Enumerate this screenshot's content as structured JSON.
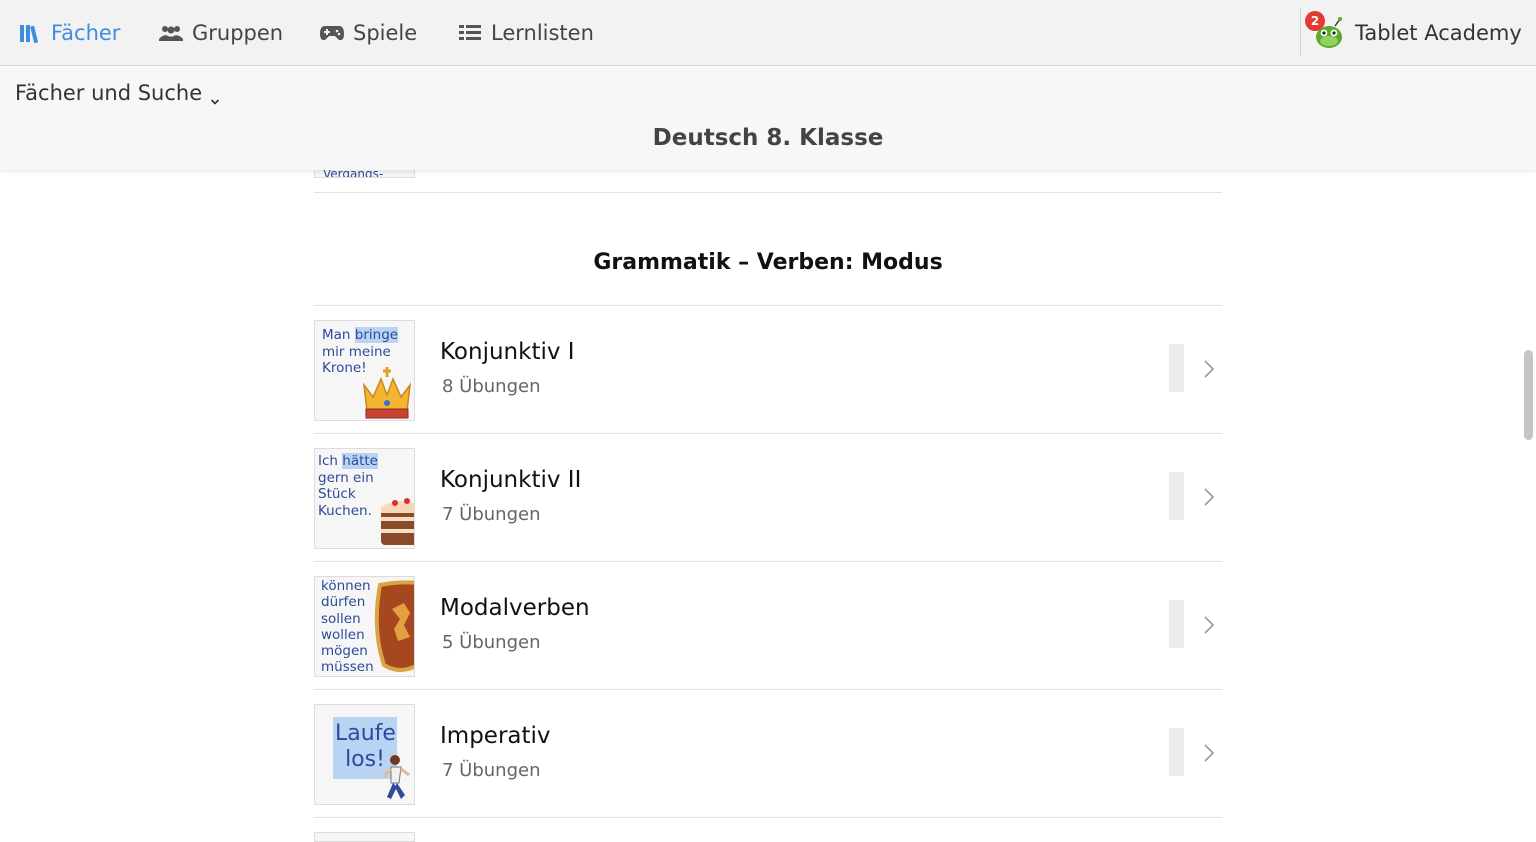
{
  "nav": {
    "faecher": "Fächer",
    "gruppen": "Gruppen",
    "spiele": "Spiele",
    "lernlisten": "Lernlisten",
    "account_name": "Tablet Academy",
    "notification_count": "2"
  },
  "subheader": {
    "dropdown_label": "Fächer und Suche",
    "page_title": "Deutsch 8. Klasse"
  },
  "partial_item": {
    "thumb_text": "Vergangs-"
  },
  "section": {
    "title": "Grammatik – Verben: Modus"
  },
  "items": [
    {
      "title": "Konjunktiv I",
      "subtitle": "8 Übungen",
      "thumb_lines": [
        "Man ",
        "bringe",
        "mir meine",
        "Krone!"
      ]
    },
    {
      "title": "Konjunktiv II",
      "subtitle": "7 Übungen",
      "thumb_lines": [
        "Ich ",
        "hätte",
        "gern ein",
        "Stück",
        "Kuchen."
      ]
    },
    {
      "title": "Modalverben",
      "subtitle": "5 Übungen",
      "thumb_lines": [
        "können",
        "dürfen",
        "sollen",
        "wollen",
        "mögen",
        "müssen"
      ]
    },
    {
      "title": "Imperativ",
      "subtitle": "7 Übungen",
      "thumb_lines": [
        "Laufe",
        "los!"
      ]
    }
  ],
  "colors": {
    "accent": "#3d8ee0",
    "thumb_text": "#2d4b9a",
    "highlight": "#b9d3f3",
    "badge": "#e23b33"
  },
  "icons": {
    "faecher": "books-icon",
    "gruppen": "users-icon",
    "spiele": "gamepad-icon",
    "lernlisten": "list-icon",
    "account": "mascot-icon",
    "row_arrow": "chevron-right-icon"
  }
}
